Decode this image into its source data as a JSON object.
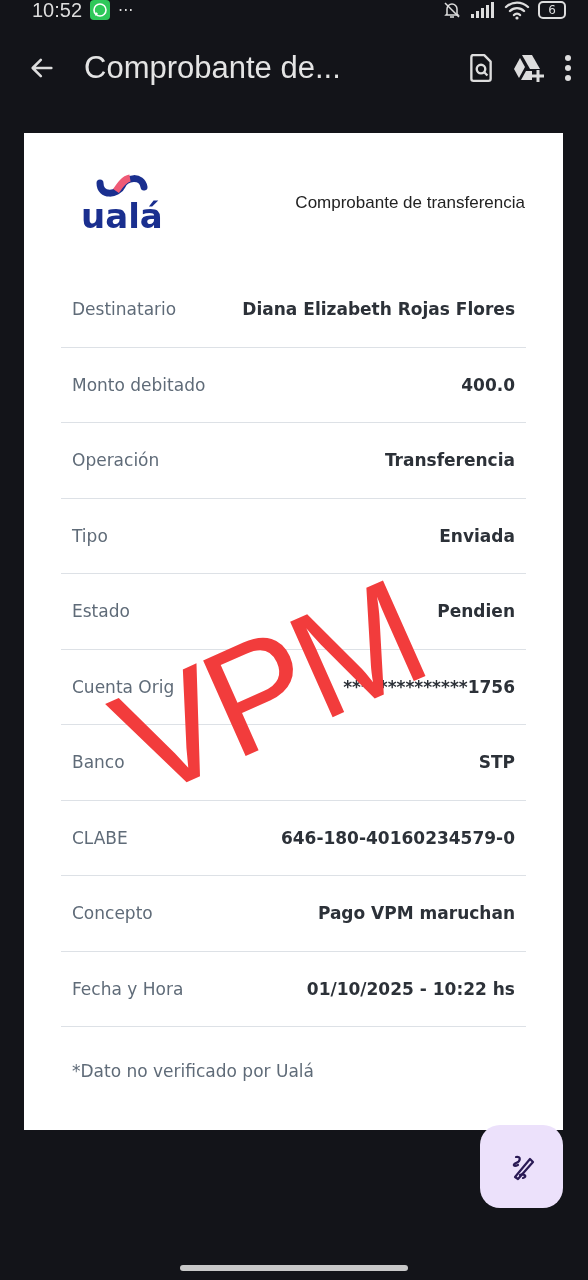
{
  "status_bar": {
    "time": "10:52",
    "more": "···",
    "battery": "6"
  },
  "app_bar": {
    "title": "Comprobante de..."
  },
  "document": {
    "logo": "ualá",
    "title": "Comprobante de transferencia",
    "rows": [
      {
        "label": "Destinatario",
        "value": "Diana Elizabeth Rojas Flores"
      },
      {
        "label": "Monto debitado",
        "value": "400.0"
      },
      {
        "label": "Operación",
        "value": "Transferencia"
      },
      {
        "label": "Tipo",
        "value": "Enviada"
      },
      {
        "label": "Estado",
        "value": "Pendien"
      },
      {
        "label": "Cuenta Orig",
        "value": "**************1756"
      },
      {
        "label": "Banco",
        "value": "STP"
      },
      {
        "label": "CLABE",
        "value": "646-180-40160234579-0"
      },
      {
        "label": "Concepto",
        "value": "Pago VPM maruchan"
      },
      {
        "label": "Fecha y Hora",
        "value": "01/10/2025 - 10:22 hs"
      }
    ],
    "note": "*Dato no verificado por Ualá"
  },
  "annotation": {
    "text": "VPM"
  }
}
